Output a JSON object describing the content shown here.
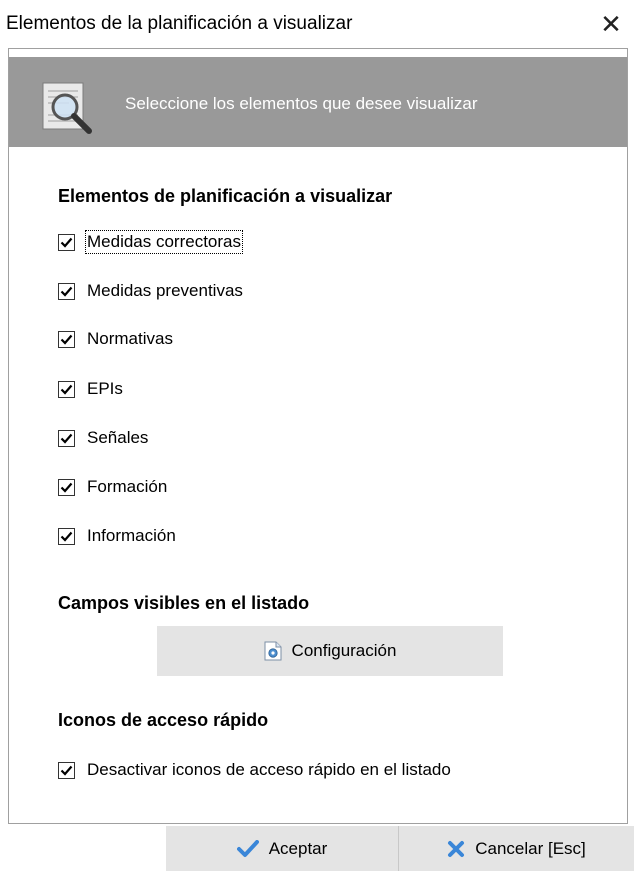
{
  "window": {
    "title": "Elementos de la planificación a visualizar",
    "close_symbol": "✕"
  },
  "header": {
    "text": "Seleccione los elementos que desee visualizar",
    "icon": "search-document-icon",
    "band_color": "#999999"
  },
  "planning_section": {
    "heading": "Elementos de planificación a visualizar",
    "items": [
      {
        "label": "Medidas correctoras",
        "checked": true
      },
      {
        "label": "Medidas preventivas",
        "checked": true
      },
      {
        "label": "Normativas",
        "checked": true
      },
      {
        "label": "EPIs",
        "checked": true
      },
      {
        "label": "Señales",
        "checked": true
      },
      {
        "label": "Formación",
        "checked": true
      },
      {
        "label": "Información",
        "checked": true
      }
    ]
  },
  "fields_section": {
    "heading": "Campos visibles en el listado",
    "config_button": "Configuración"
  },
  "shortcuts_section": {
    "heading": "Iconos de acceso rápido",
    "items": [
      {
        "label": "Desactivar iconos de acceso rápido en el listado",
        "checked": true
      }
    ]
  },
  "footer": {
    "accept_label": "Aceptar",
    "cancel_label": "Cancelar [Esc]"
  }
}
